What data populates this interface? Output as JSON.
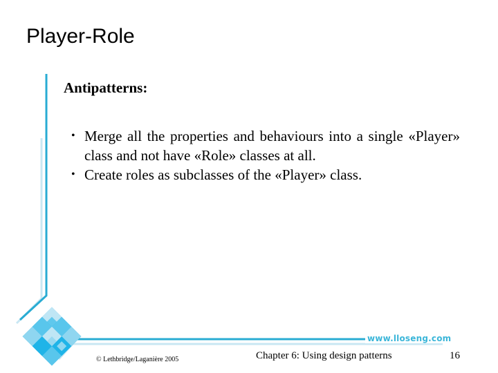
{
  "slide": {
    "title": "Player-Role",
    "subheading": "Antipatterns:",
    "bullets": [
      {
        "marker": "•",
        "text": "Merge all the properties and behaviours into a single «Player» class and not have «Role» classes at all."
      },
      {
        "marker": "•",
        "text": "Create roles as subclasses of the «Player» class."
      }
    ]
  },
  "footer": {
    "copyright": "© Lethbridge/Laganière 2005",
    "chapter": "Chapter 6: Using design patterns",
    "page_number": "16",
    "url": "www.lloseng.com"
  },
  "theme": {
    "accent_dark": "#29acd3",
    "accent_light": "#c9e7f3",
    "tile_colors": [
      "#1fb4e8",
      "#59c6ec",
      "#8fd6f0",
      "#bfe6f5"
    ]
  }
}
